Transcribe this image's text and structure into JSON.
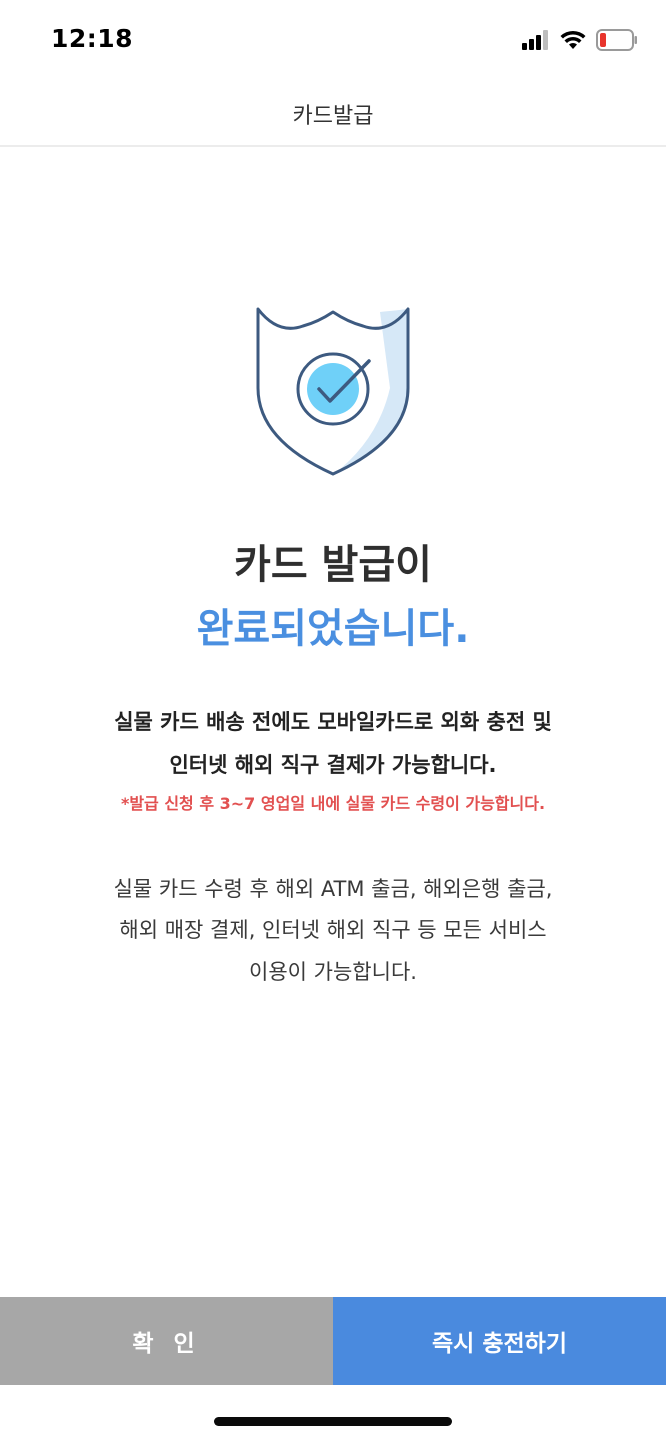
{
  "status_bar": {
    "time": "12:18",
    "icons": [
      "cellular-signal-icon",
      "wifi-icon",
      "battery-low-icon"
    ]
  },
  "nav": {
    "title": "카드발급"
  },
  "content": {
    "headline_line1": "카드 발급이",
    "headline_line2": "완료되었습니다.",
    "info_bold_line1": "실물 카드 배송 전에도 모바일카드로 외화 충전 및",
    "info_bold_line2": "인터넷 해외 직구 결제가 가능합니다.",
    "warning": "*발급 신청 후 3~7 영업일 내에 실물 카드 수령이 가능합니다.",
    "info_line1": "실물 카드 수령 후 해외 ATM 출금, 해외은행 출금,",
    "info_line2": "해외 매장 결제, 인터넷 해외 직구 등 모든 서비스",
    "info_line3": "이용이 가능합니다."
  },
  "buttons": {
    "confirm": "확 인",
    "charge_now": "즉시 충전하기"
  },
  "colors": {
    "accent_blue": "#4a8ade",
    "headline_blue": "#4a8fe0",
    "warning_red": "#e25050",
    "confirm_gray": "#a7a7a7",
    "shield_stroke": "#3d5a80",
    "check_circle": "#6fd0f8"
  }
}
